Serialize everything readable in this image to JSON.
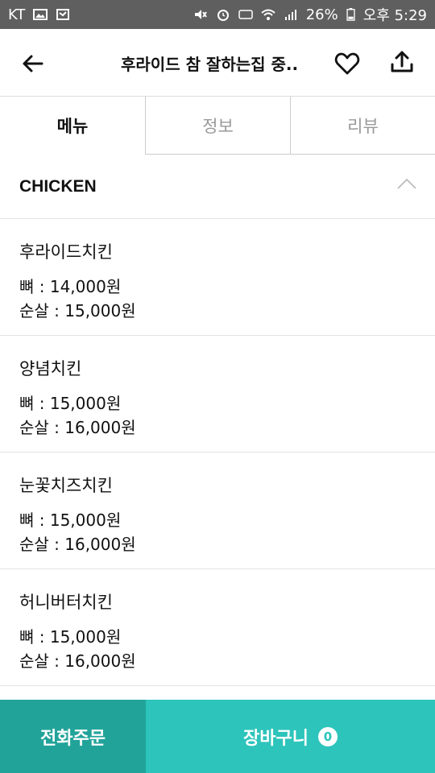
{
  "status_bar": {
    "carrier": "KT",
    "battery": "26%",
    "time": "오후 5:29"
  },
  "header": {
    "title": "후라이드 참 잘하는집 중.."
  },
  "tabs": [
    {
      "label": "메뉴",
      "active": true
    },
    {
      "label": "정보",
      "active": false
    },
    {
      "label": "리뷰",
      "active": false
    }
  ],
  "category": {
    "title": "CHICKEN"
  },
  "menu_items": [
    {
      "name": "후라이드치킨",
      "price_bone": "뼈 : 14,000원",
      "price_boneless": "순살 : 15,000원"
    },
    {
      "name": "양념치킨",
      "price_bone": "뼈 : 15,000원",
      "price_boneless": "순살 : 16,000원"
    },
    {
      "name": "눈꽃치즈치킨",
      "price_bone": "뼈 : 15,000원",
      "price_boneless": "순살 : 16,000원"
    },
    {
      "name": "허니버터치킨",
      "price_bone": "뼈 : 15,000원",
      "price_boneless": "순살 : 16,000원"
    }
  ],
  "bottom_bar": {
    "phone_order_label": "전화주문",
    "cart_label": "장바구니",
    "cart_count": "0"
  },
  "colors": {
    "accent": "#2cc4bb",
    "accent_dark": "#22a39a",
    "status_bar": "#5f5f5f"
  }
}
